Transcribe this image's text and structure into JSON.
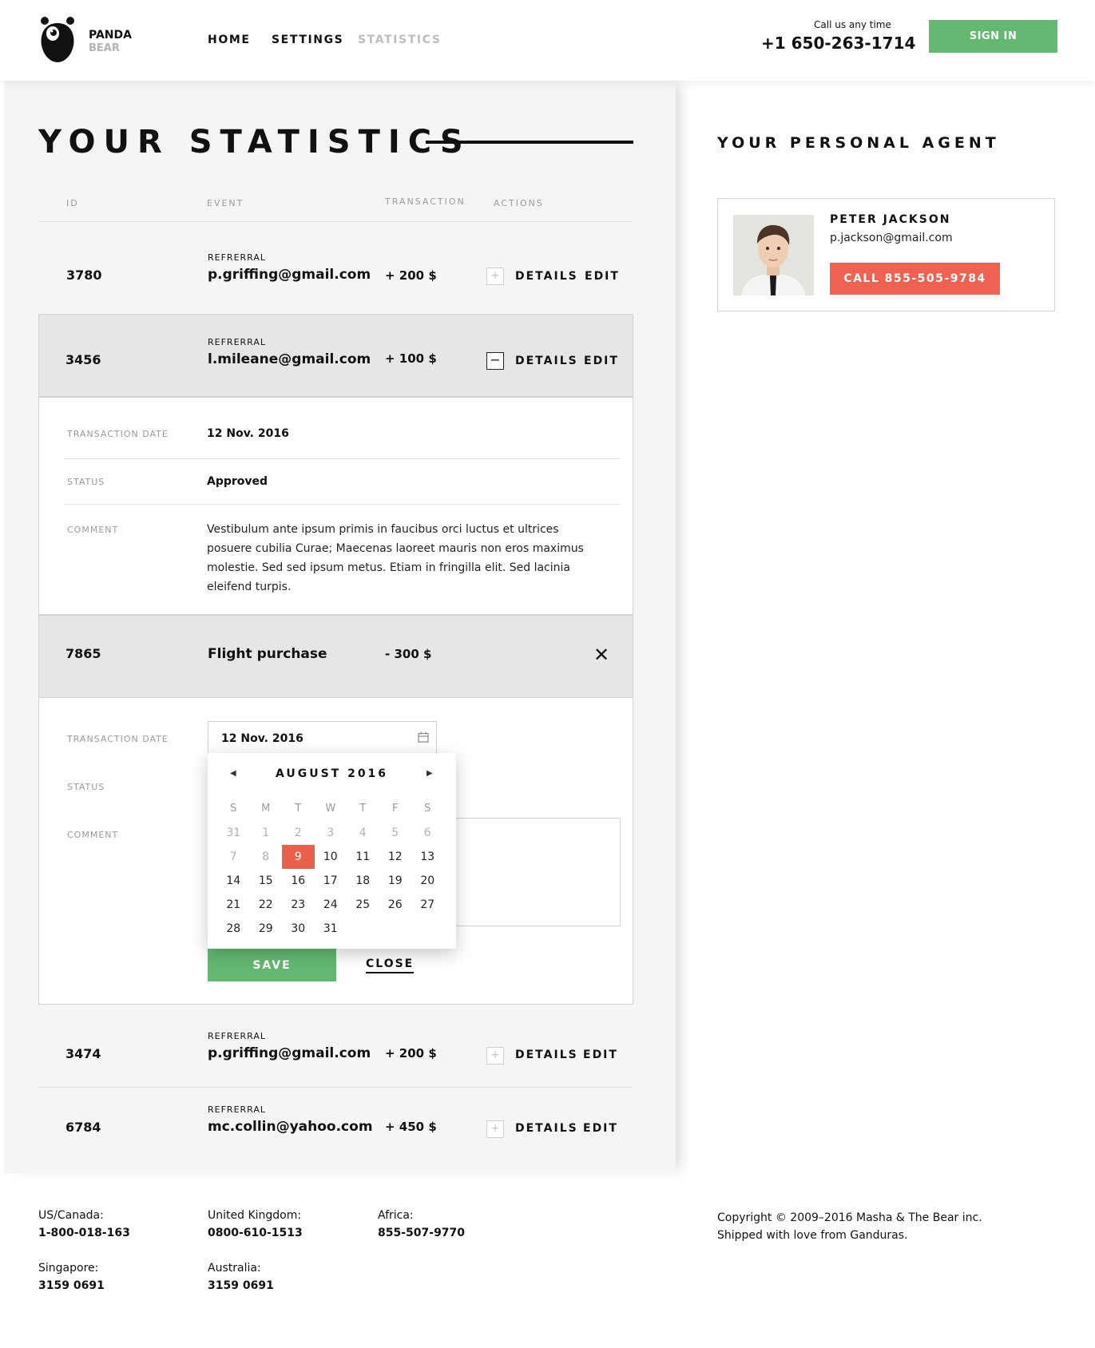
{
  "header": {
    "brand_line1": "PANDA",
    "brand_line2": "BEAR",
    "nav": [
      "HOME",
      "SETTINGS",
      "STATISTICS"
    ],
    "call_label": "Call us any time",
    "phone": "+1 650-263-1714",
    "signin_label": "SIGN IN"
  },
  "stats": {
    "title": "YOUR STATISTICS",
    "columns": [
      "ID",
      "EVENT",
      "TRANSACTION",
      "ACTIONS"
    ],
    "details_label": "DETAILS",
    "edit_label": "EDIT",
    "rows": [
      {
        "id": "3780",
        "type": "REFRERRAL",
        "email": "p.griffing@gmail.com",
        "amount": "+ 200 $"
      },
      {
        "id": "3456",
        "type": "REFRERRAL",
        "email": "l.mileane@gmail.com",
        "amount": "+ 100 $"
      },
      {
        "id": "7865",
        "event": "Flight purchase",
        "amount": "- 300 $"
      },
      {
        "id": "3474",
        "type": "REFRERRAL",
        "email": "p.griffing@gmail.com",
        "amount": "+ 200 $"
      },
      {
        "id": "6784",
        "type": "REFRERRAL",
        "email": "mc.collin@yahoo.com",
        "amount": "+ 450 $"
      }
    ],
    "expanded": {
      "date_label": "TRANSACTION DATE",
      "date": "12 Nov. 2016",
      "status_label": "STATUS",
      "status": "Approved",
      "comment_label": "COMMENT",
      "comment": "Vestibulum ante ipsum primis in faucibus orci luctus et ultrices posuere cubilia Curae; Maecenas laoreet mauris non eros maximus molestie. Sed sed ipsum metus. Etiam in fringilla elit. Sed lacinia eleifend turpis."
    },
    "edit_form": {
      "date_label": "TRANSACTION DATE",
      "date_value": "12 Nov. 2016",
      "status_label": "STATUS",
      "comment_label": "COMMENT",
      "save_label": "SAVE",
      "close_label": "CLOSE"
    }
  },
  "datepicker": {
    "title": "AUGUST 2016",
    "prev_icon": "caret-left-icon",
    "next_icon": "caret-right-icon",
    "weekdays": [
      "S",
      "M",
      "T",
      "W",
      "T",
      "F",
      "S"
    ],
    "weeks": [
      [
        "31",
        "1",
        "2",
        "3",
        "4",
        "5",
        "6"
      ],
      [
        "7",
        "8",
        "9",
        "10",
        "11",
        "12",
        "13"
      ],
      [
        "14",
        "15",
        "16",
        "17",
        "18",
        "19",
        "20"
      ],
      [
        "21",
        "22",
        "23",
        "24",
        "25",
        "26",
        "27"
      ],
      [
        "28",
        "29",
        "30",
        "31",
        "",
        "",
        ""
      ]
    ],
    "selected": "9",
    "accent": "#e9604b"
  },
  "agent": {
    "heading": "YOUR PERSONAL AGENT",
    "name": "PETER JACKSON",
    "email": "p.jackson@gmail.com",
    "call_label": "CALL 855-505-9784"
  },
  "footer": {
    "contacts": [
      {
        "region": "US/Canada:",
        "phone": "1-800-018-163"
      },
      {
        "region": "United Kingdom:",
        "phone": "0800-610-1513"
      },
      {
        "region": "Africa:",
        "phone": "855-507-9770"
      },
      {
        "region": "Singapore:",
        "phone": "3159 0691"
      },
      {
        "region": "Australia:",
        "phone": "3159 0691"
      }
    ],
    "copyright": "Copyright © 2009–2016 Masha & The Bear inc.",
    "tagline": "Shipped with love from Ganduras."
  },
  "colors": {
    "green": "#64b872",
    "red": "#ef6150"
  }
}
